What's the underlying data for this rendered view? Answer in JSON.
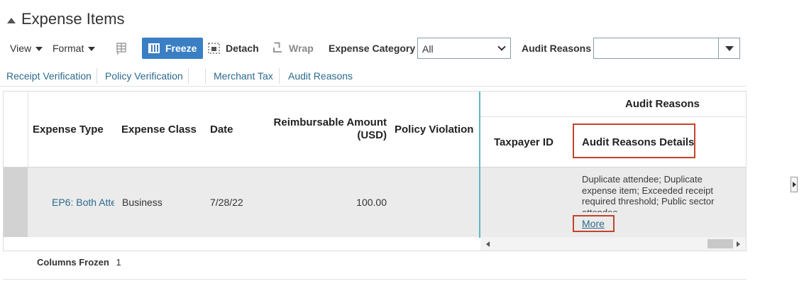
{
  "section": {
    "title": "Expense Items"
  },
  "toolbar": {
    "view_label": "View",
    "format_label": "Format",
    "freeze_label": "Freeze",
    "detach_label": "Detach",
    "wrap_label": "Wrap",
    "expense_category_label": "Expense Category",
    "expense_category_value": "All",
    "audit_reasons_label": "Audit Reasons",
    "audit_reasons_value": ""
  },
  "column_groups": [
    {
      "label": "Receipt Verification"
    },
    {
      "label": "Policy Verification"
    },
    {
      "label": "Merchant Tax"
    },
    {
      "label": "Audit Reasons"
    }
  ],
  "table": {
    "group_header": "Audit Reasons",
    "headers": {
      "expense_type": "Expense Type",
      "expense_class": "Expense Class",
      "date": "Date",
      "reimbursable_amount": "Reimbursable Amount (USD)",
      "policy_violation": "Policy Violation",
      "taxpayer_id": "Taxpayer ID",
      "audit_reasons_details": "Audit Reasons Details"
    },
    "rows": [
      {
        "expense_type": "EP6: Both Atte",
        "expense_class": "Business",
        "date": "7/28/22",
        "reimbursable_amount": "100.00",
        "policy_violation": "",
        "taxpayer_id": "",
        "audit_reasons_details": "Duplicate attendee; Duplicate expense item; Exceeded receipt required threshold; Public sector attendee",
        "more_label": "More"
      }
    ]
  },
  "footer": {
    "columns_frozen_label": "Columns Frozen",
    "columns_frozen_value": "1"
  },
  "colors": {
    "accent": "#3a7fc4",
    "link": "#2b6a8e",
    "highlight": "#c0442b",
    "frozen_divider": "#5fb6c6"
  }
}
